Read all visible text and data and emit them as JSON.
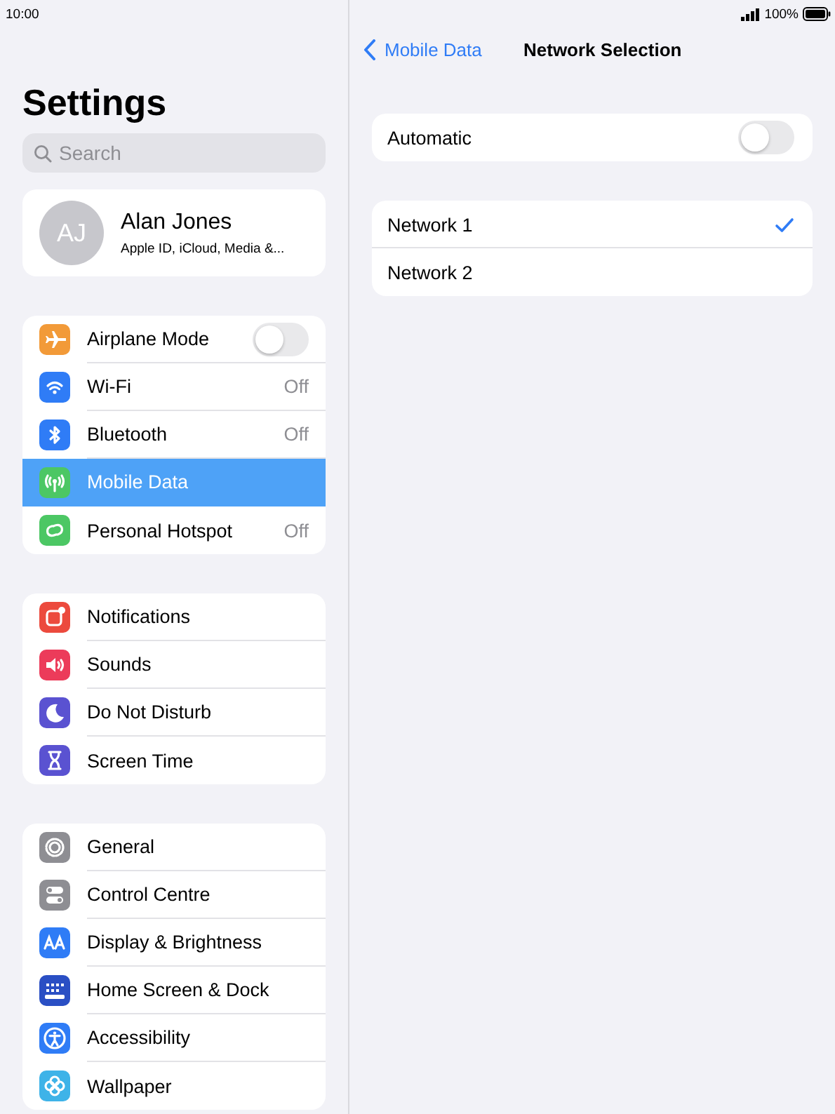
{
  "status_bar": {
    "time": "10:00",
    "battery": "100%"
  },
  "sidebar": {
    "title": "Settings",
    "search": {
      "placeholder": "Search"
    },
    "profile": {
      "initials": "AJ",
      "name": "Alan Jones",
      "subtitle": "Apple ID, iCloud, Media &..."
    },
    "groups": [
      [
        {
          "label": "Airplane Mode",
          "kind": "toggle",
          "on": false,
          "selected": false,
          "color": "#f29a38"
        },
        {
          "label": "Wi-Fi",
          "kind": "value",
          "value": "Off",
          "selected": false,
          "color": "#2f7cf6"
        },
        {
          "label": "Bluetooth",
          "kind": "value",
          "value": "Off",
          "selected": false,
          "color": "#2f7cf6"
        },
        {
          "label": "Mobile Data",
          "kind": "plain",
          "selected": true,
          "color": "#4cc764"
        },
        {
          "label": "Personal Hotspot",
          "kind": "value",
          "value": "Off",
          "selected": false,
          "color": "#4cc764"
        }
      ],
      [
        {
          "label": "Notifications",
          "kind": "plain",
          "selected": false,
          "color": "#ec4a3d"
        },
        {
          "label": "Sounds",
          "kind": "plain",
          "selected": false,
          "color": "#ec3b5a"
        },
        {
          "label": "Do Not Disturb",
          "kind": "plain",
          "selected": false,
          "color": "#5a52d1"
        },
        {
          "label": "Screen Time",
          "kind": "plain",
          "selected": false,
          "color": "#5a52d1"
        }
      ],
      [
        {
          "label": "General",
          "kind": "plain",
          "selected": false,
          "color": "#8e8e93"
        },
        {
          "label": "Control Centre",
          "kind": "plain",
          "selected": false,
          "color": "#8e8e93"
        },
        {
          "label": "Display & Brightness",
          "kind": "plain",
          "selected": false,
          "color": "#2f7cf6"
        },
        {
          "label": "Home Screen & Dock",
          "kind": "plain",
          "selected": false,
          "color": "#2a4fc4"
        },
        {
          "label": "Accessibility",
          "kind": "plain",
          "selected": false,
          "color": "#2f7cf6"
        },
        {
          "label": "Wallpaper",
          "kind": "plain",
          "selected": false,
          "color": "#3eb3e8"
        }
      ]
    ]
  },
  "detail": {
    "back": "Mobile Data",
    "title": "Network Selection",
    "automatic": {
      "label": "Automatic",
      "on": false
    },
    "networks": [
      {
        "label": "Network 1",
        "selected": true
      },
      {
        "label": "Network 2",
        "selected": false
      }
    ]
  }
}
